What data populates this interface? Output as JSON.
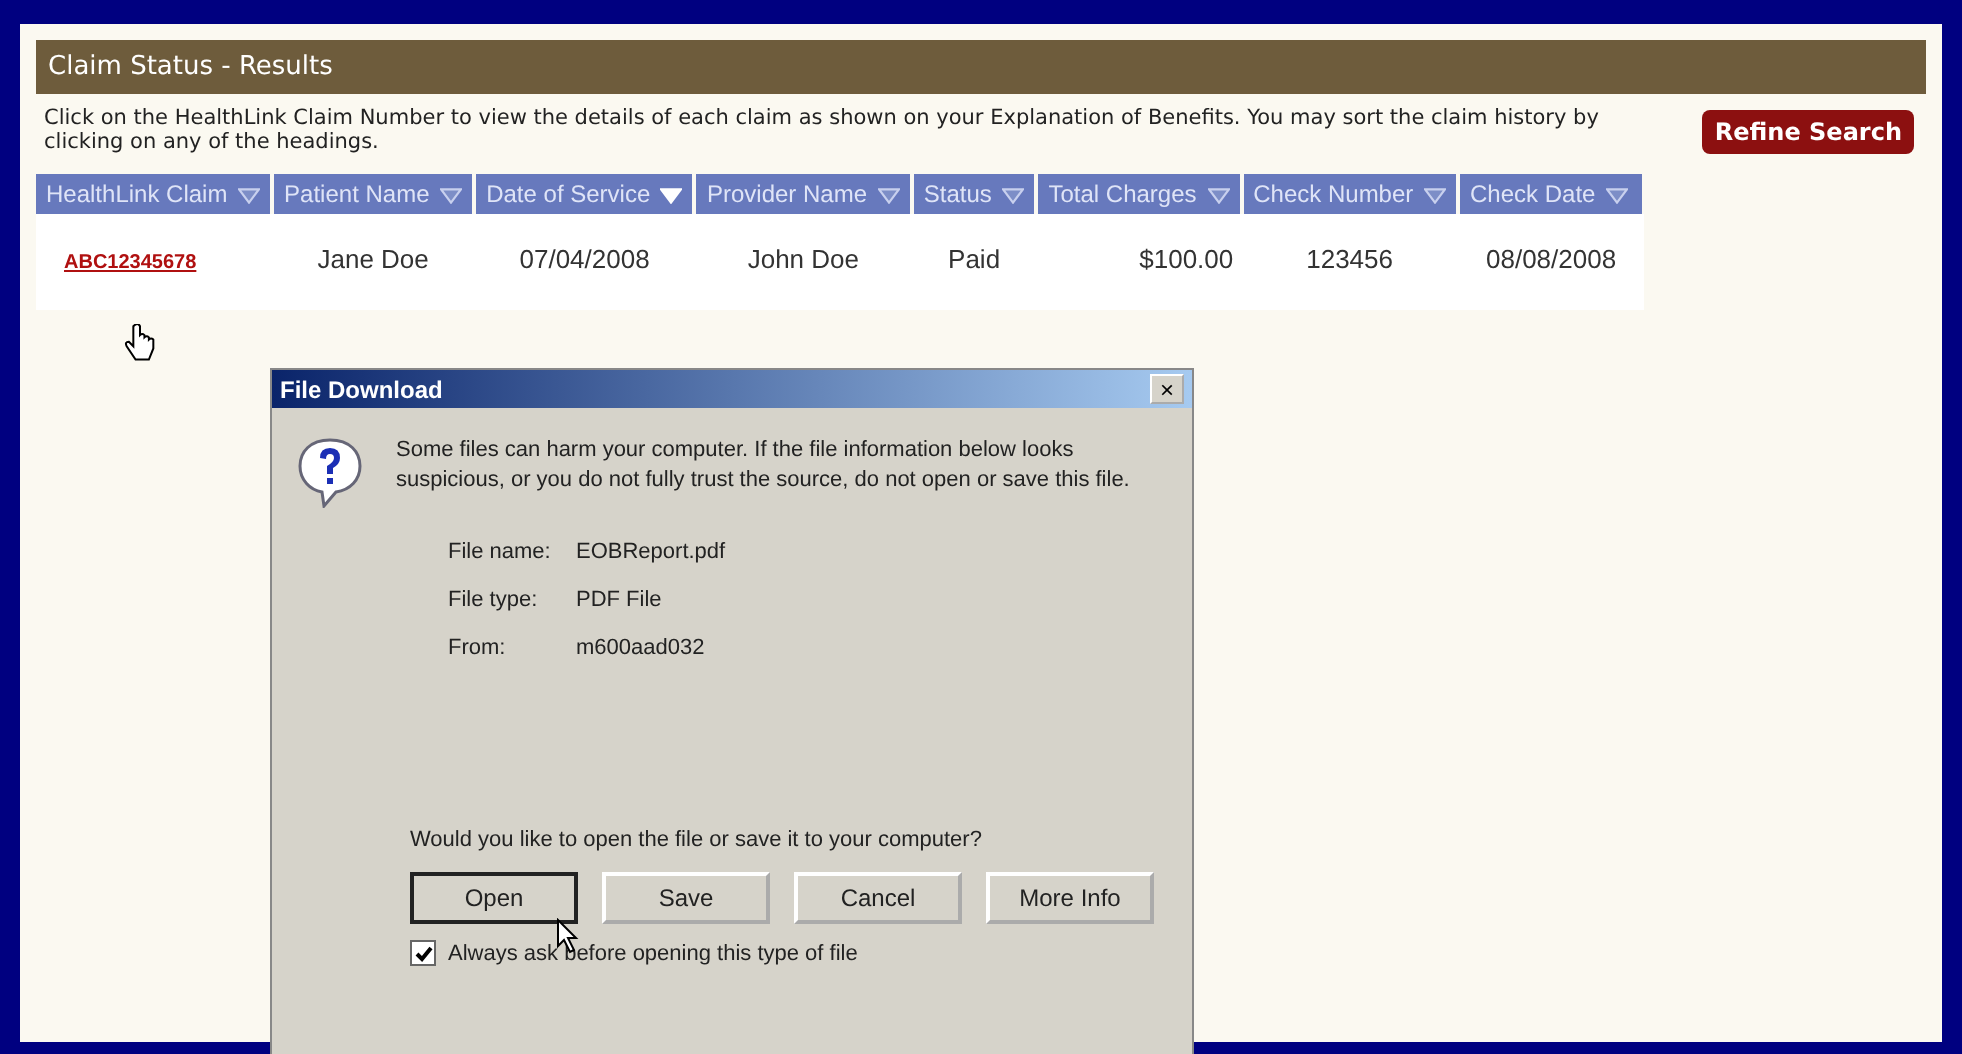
{
  "page": {
    "title": "Claim Status - Results",
    "intro": "Click on the HealthLink Claim Number to view the details of each claim as shown on your Explanation of Benefits. You may sort the claim history by clicking on any of the headings.",
    "refine_button": "Refine Search"
  },
  "table": {
    "columns": [
      {
        "label": "HealthLink Claim",
        "sorted": false
      },
      {
        "label": "Patient Name",
        "sorted": false
      },
      {
        "label": "Date of Service",
        "sorted": true
      },
      {
        "label": "Provider Name",
        "sorted": false
      },
      {
        "label": "Status",
        "sorted": false
      },
      {
        "label": "Total Charges",
        "sorted": false
      },
      {
        "label": "Check Number",
        "sorted": false
      },
      {
        "label": "Check Date",
        "sorted": false
      }
    ],
    "rows": [
      {
        "claim": "ABC12345678",
        "patient": "Jane Doe",
        "date_of_service": "07/04/2008",
        "provider": "John Doe",
        "status": "Paid",
        "total_charges": "$100.00",
        "check_number": "123456",
        "check_date": "08/08/2008"
      }
    ]
  },
  "dialog": {
    "title": "File Download",
    "close": "×",
    "warning": "Some files can harm your computer. If the file information below looks suspicious, or you do not fully trust the source, do not open or save this file.",
    "fields": [
      {
        "label": "File name:",
        "value": "EOBReport.pdf"
      },
      {
        "label": "File type:",
        "value": "PDF File"
      },
      {
        "label": "From:",
        "value": "m600aad032"
      }
    ],
    "question": "Would you like to open the file or save it to your computer?",
    "buttons": [
      {
        "label": "Open",
        "default": true
      },
      {
        "label": "Save",
        "default": false
      },
      {
        "label": "Cancel",
        "default": false
      },
      {
        "label": "More Info",
        "default": false
      }
    ],
    "always_ask": {
      "label": "Always ask before opening this type of file",
      "checked": true
    }
  }
}
